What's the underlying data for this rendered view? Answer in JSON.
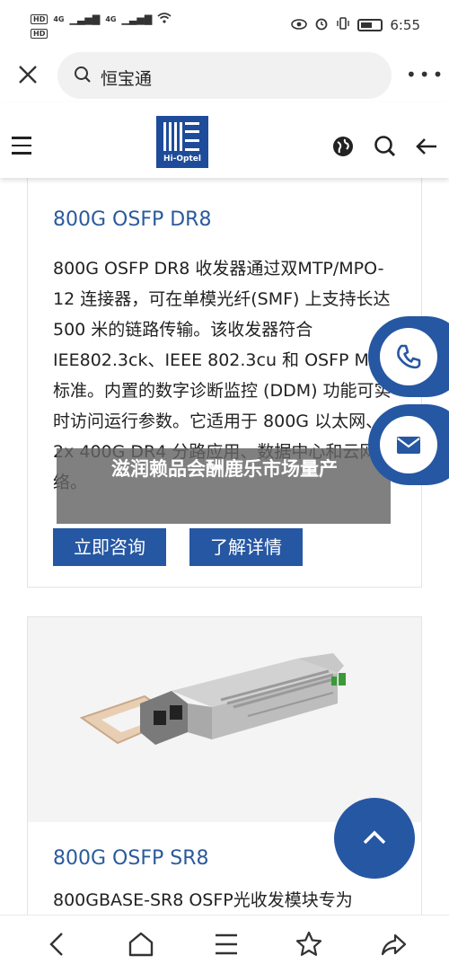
{
  "status": {
    "sim1": "HD",
    "sim2": "HD",
    "net1": "4G",
    "net2": "4G",
    "time": "6:55"
  },
  "browser": {
    "search_text": "恒宝通"
  },
  "site": {
    "logo_text": "Hi-Optel"
  },
  "product1": {
    "title": "800G OSFP DR8",
    "description": "800G OSFP DR8 收发器通过双MTP/MPO-12 连接器，可在单模光纤(SMF) 上支持长达 500 米的链路传输。该收发器符合 IEE802.3ck、IEEE 802.3cu 和 OSFP MSA 标准。内置的数字诊断监控 (DDM) 功能可实时访问运行参数。它适用于 800G 以太网、2x 400G DR4 分路应用、数据中心和云网络。",
    "consult_label": "立即咨询",
    "details_label": "了解详情"
  },
  "news_banner": {
    "text": "滋润赖品会酬鹿乐市场量产"
  },
  "product2": {
    "title": "800G OSFP SR8",
    "description": "800GBASE-SR8 OSFP光收发模块专为"
  },
  "colors": {
    "brand": "#2657a3",
    "title": "#2a5a9d"
  },
  "icons": [
    "close-icon",
    "search-icon",
    "more-icon",
    "menu-icon",
    "globe-icon",
    "back-arrow-icon",
    "phone-icon",
    "mail-icon",
    "chevron-up-icon",
    "nav-back-icon",
    "home-icon",
    "tabs-icon",
    "star-icon",
    "share-icon"
  ]
}
